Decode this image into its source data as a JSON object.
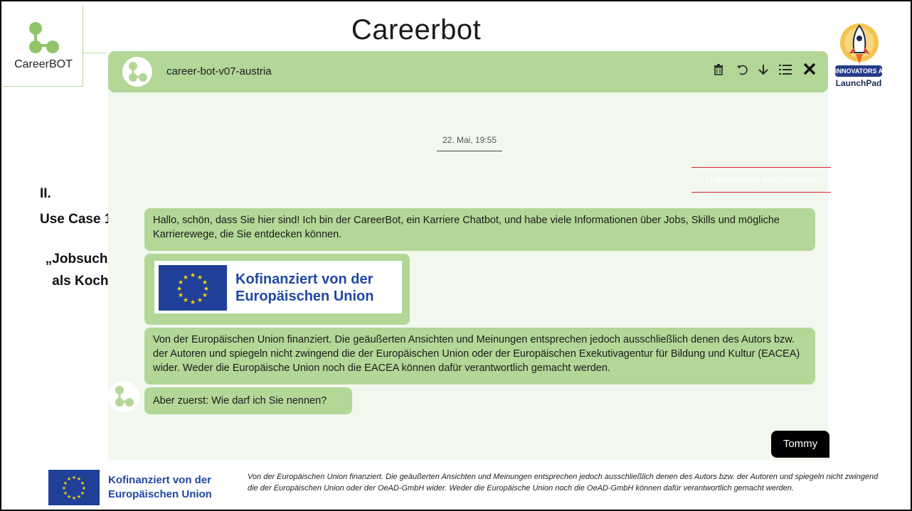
{
  "slide": {
    "title": "Careerbot",
    "logo_text": "CareerBOT",
    "badge": {
      "ribbon": "INNOVATORS AI",
      "sub": "LaunchPad"
    },
    "side_labels": {
      "section": "II.",
      "use_case": "Use Case 1",
      "quote": "„Jobsuche als Koch“"
    }
  },
  "chat": {
    "header": {
      "bot_name": "career-bot-v07-austria",
      "icons": [
        "trash-icon",
        "undo-icon",
        "download-icon",
        "list-icon",
        "close-icon"
      ]
    },
    "date": "22. Mai, 19:55",
    "reset_label": "Unterhaltung zurücksetzen",
    "messages": {
      "greeting": "Hallo, schön, dass Sie hier sind! Ich bin der CareerBot, ein Karriere Chatbot, und habe viele Informationen über Jobs, Skills und mögliche Karrierewege, die Sie entdecken können.",
      "eu_card_line1": "Kofinanziert von der",
      "eu_card_line2": "Europäischen Union",
      "disclaimer": "Von der Europäischen Union finanziert. Die geäußerten Ansichten und Meinungen entsprechen jedoch ausschließlich denen des Autors bzw. der Autoren und spiegeln nicht zwingend die der Europäischen Union oder der Europäischen Exekutivagentur für Bildung und Kultur (EACEA) wider. Weder die Europäische Union noch die EACEA können dafür verantwortlich gemacht werden.",
      "question": "Aber zuerst: Wie darf ich Sie nennen?",
      "user_reply": "Tommy"
    }
  },
  "footer": {
    "eu_line1": "Kofinanziert von der",
    "eu_line2": "Europäischen Union",
    "disclaimer": "Von der Europäischen Union finanziert. Die geäußerten Ansichten und Meinungen entsprechen jedoch ausschließlich denen des Autors bzw. der Autoren und spiegeln nicht zwingend die der Europäischen Union oder der OeAD-GmbH wider. Weder die Europäische Union noch die OeAD-GmbH können dafür verantwortlich gemacht werden."
  },
  "colors": {
    "bot_green": "#b3d797",
    "chat_bg": "#f2f8ee",
    "eu_blue": "#1f3f99",
    "eu_text": "#1f48a3",
    "reset_line": "#dd2233"
  }
}
